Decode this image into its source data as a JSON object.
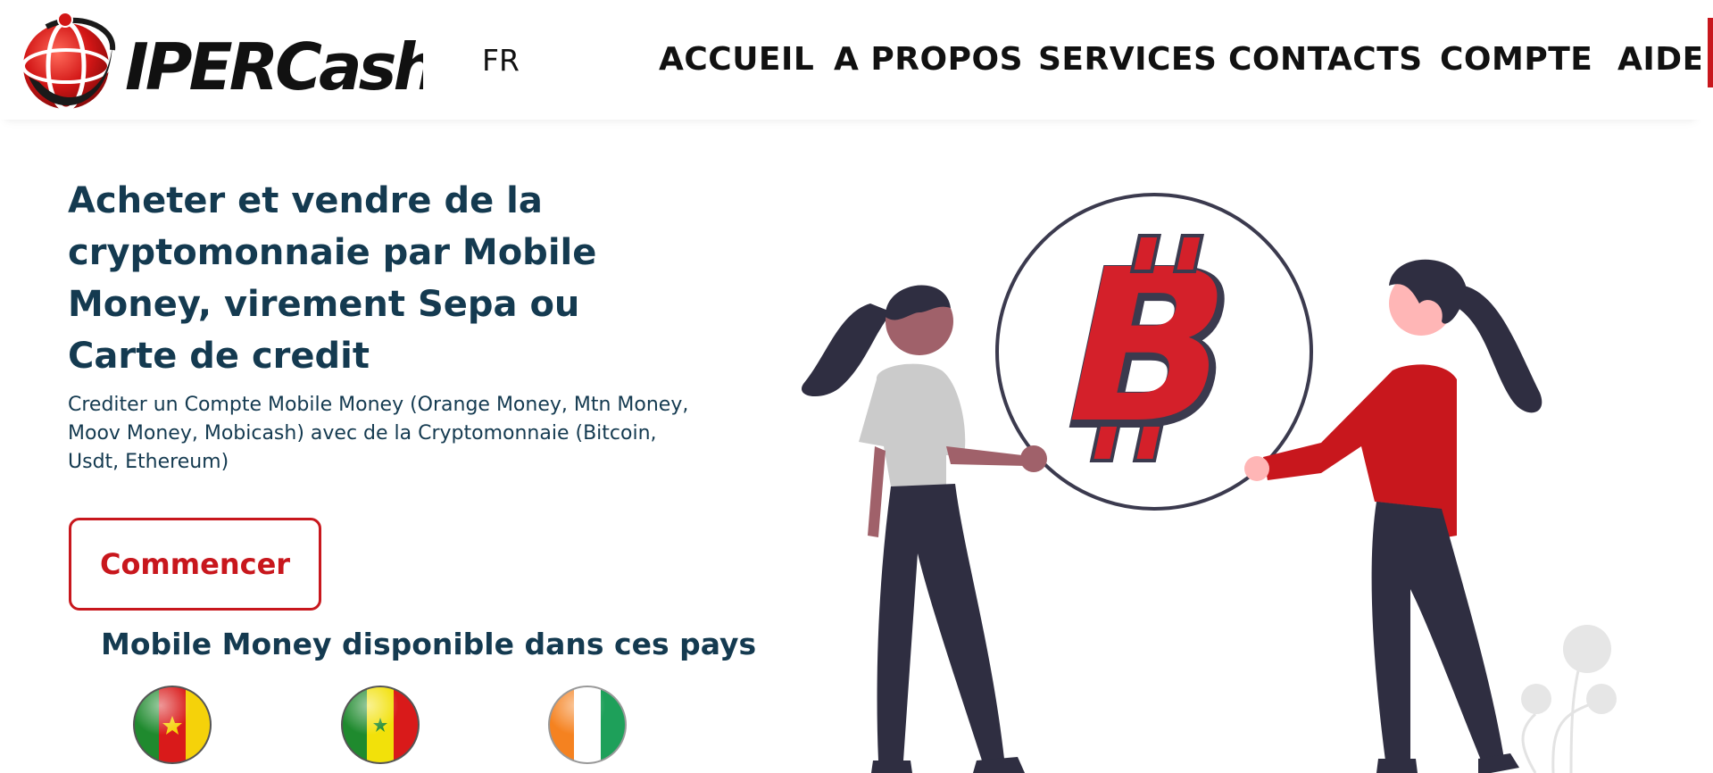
{
  "header": {
    "brand": "IPERCash",
    "language": "FR",
    "nav": [
      {
        "label": "ACCUEIL"
      },
      {
        "label": "A PROPOS"
      },
      {
        "label": "SERVICES"
      },
      {
        "label": "CONTACTS"
      },
      {
        "label": "COMPTE"
      },
      {
        "label": "AIDE"
      }
    ]
  },
  "hero": {
    "title": "Acheter et vendre de la cryptomonnaie par Mobile Money, virement Sepa ou Carte de credit",
    "description": "Crediter un Compte Mobile Money (Orange Money, Mtn Money, Moov Money, Mobicash) avec de la Cryptomonnaie (Bitcoin, Usdt, Ethereum)",
    "cta": "Commencer"
  },
  "countries": {
    "title": "Mobile Money disponible dans ces pays",
    "flags": [
      {
        "name": "cameroon-flag-icon"
      },
      {
        "name": "senegal-flag-icon"
      },
      {
        "name": "cote-divoire-flag-icon"
      }
    ]
  },
  "colors": {
    "brand_red": "#c8171d",
    "heading_navy": "#143a50",
    "figure_dark": "#2f2e41"
  }
}
